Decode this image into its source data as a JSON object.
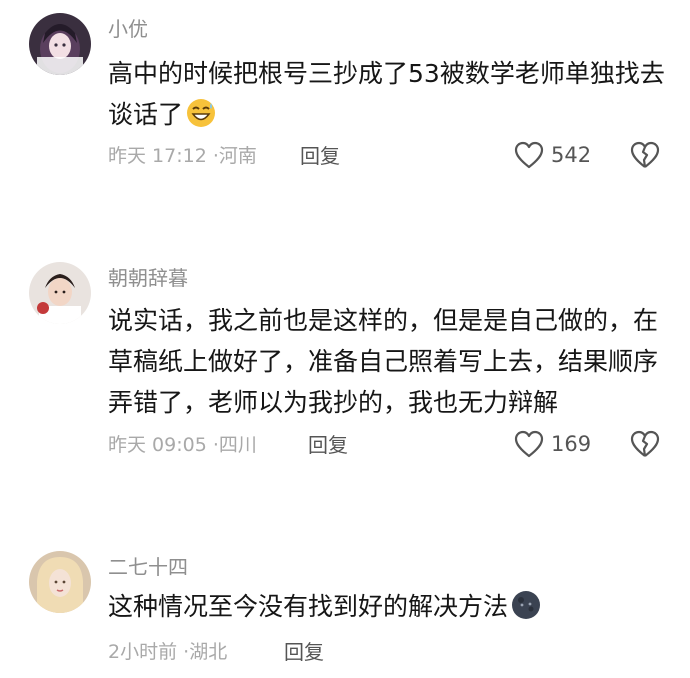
{
  "comments": [
    {
      "username": "小优",
      "content": "高中的时候把根号三抄成了53被数学老师单独找去谈话了",
      "emoji": "grinning-sweat-emoji",
      "time": "昨天 17:12",
      "location": "河南",
      "reply_label": "回复",
      "likes": "542"
    },
    {
      "username": "朝朝辞暮",
      "content": "说实话，我之前也是这样的，但是是自己做的，在草稿纸上做好了，准备自己照着写上去，结果顺序弄错了，老师以为我抄的，我也无力辩解",
      "time": "昨天 09:05",
      "location": "四川",
      "reply_label": "回复",
      "likes": "169"
    },
    {
      "username": "二七十四",
      "content": "这种情况至今没有找到好的解决方法",
      "emoji": "dark-moon-face-emoji",
      "time": "2小时前",
      "location": "湖北",
      "reply_label": "回复"
    }
  ],
  "meta_separator": "·",
  "colors": {
    "username": "#8f8f8f",
    "content": "#161616",
    "meta": "#a9a9a9",
    "action": "#555555"
  }
}
